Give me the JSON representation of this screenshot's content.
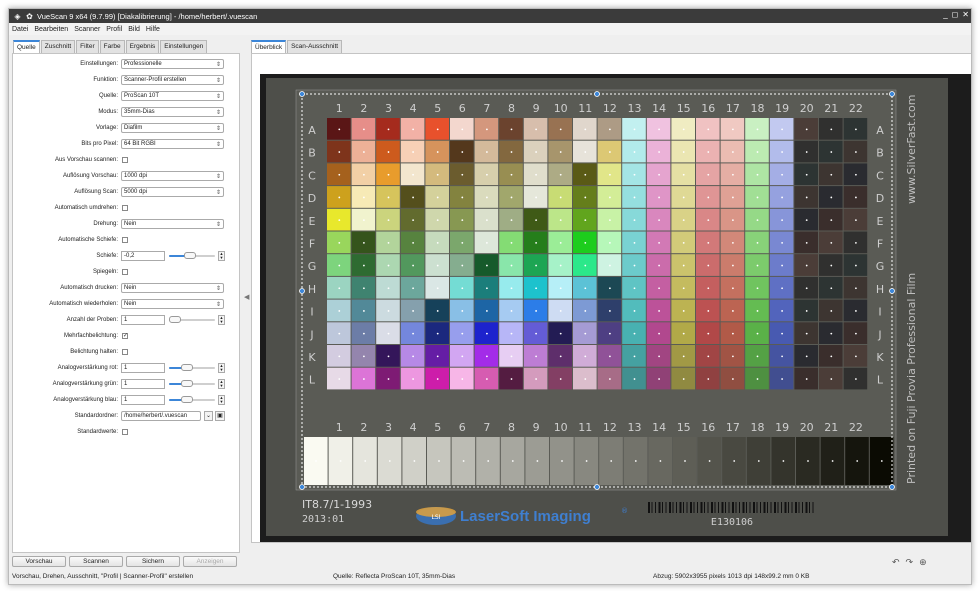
{
  "window": {
    "title": "VueScan 9 x64 (9.7.99) [Diakalibrierung] - /home/herbert/.vuescan",
    "controls": [
      "_",
      "◻",
      "✕"
    ]
  },
  "menu": [
    "Datei",
    "Bearbeiten",
    "Scanner",
    "Profil",
    "Bild",
    "Hilfe"
  ],
  "left_tabs": [
    "Quelle",
    "Zuschnitt",
    "Filter",
    "Farbe",
    "Ergebnis",
    "Einstellungen"
  ],
  "right_tabs": [
    "Überblick",
    "Scan-Ausschnitt"
  ],
  "settings": {
    "einstellungen": {
      "label": "Einstellungen:",
      "value": "Professionelle"
    },
    "funktion": {
      "label": "Funktion:",
      "value": "Scanner-Profil erstellen"
    },
    "quelle": {
      "label": "Quelle:",
      "value": "ProScan 10T"
    },
    "modus": {
      "label": "Modus:",
      "value": "35mm-Dias"
    },
    "vorlage": {
      "label": "Vorlage:",
      "value": "Diafilm"
    },
    "bits": {
      "label": "Bits pro Pixel:",
      "value": "64 Bit RGBI"
    },
    "aus_vorschau": {
      "label": "Aus Vorschau scannen:"
    },
    "aufl_vorschau": {
      "label": "Auflösung Vorschau:",
      "value": "1000 dpi"
    },
    "aufl_scan": {
      "label": "Auflösung Scan:",
      "value": "5000 dpi"
    },
    "auto_umdrehen": {
      "label": "Automatisch umdrehen:"
    },
    "drehung": {
      "label": "Drehung:",
      "value": "Nein"
    },
    "auto_schiefe": {
      "label": "Automatische Schiefe:"
    },
    "schiefe": {
      "label": "Schiefe:",
      "value": "-0,2",
      "level": 0.45
    },
    "spiegeln": {
      "label": "Spiegeln:"
    },
    "auto_drucken": {
      "label": "Automatisch drucken:",
      "value": "Nein"
    },
    "auto_wiederholen": {
      "label": "Automatisch wiederholen:",
      "value": "Nein"
    },
    "proben": {
      "label": "Anzahl der Proben:",
      "value": "1",
      "level": 0.0
    },
    "mehrfach": {
      "label": "Mehrfachbelichtung:",
      "checked": "✓"
    },
    "belichtung": {
      "label": "Belichtung halten:"
    },
    "verst_rot": {
      "label": "Analogverstärkung rot:",
      "value": "1",
      "level": 0.4
    },
    "verst_gruen": {
      "label": "Analogverstärkung grün:",
      "value": "1",
      "level": 0.4
    },
    "verst_blau": {
      "label": "Analogverstärkung blau:",
      "value": "1",
      "level": 0.4
    },
    "ordner": {
      "label": "Standardordner:",
      "value": "/home/herbert/.vuescan"
    },
    "standardwerte": {
      "label": "Standardwerte:"
    }
  },
  "buttons": {
    "vorschau": "Vorschau",
    "scannen": "Scannen",
    "sichern": "Sichern",
    "anzeigen": "Anzeigen"
  },
  "tools": {
    "rotate_left": "↶",
    "rotate_right": "↷",
    "zoom": "⊕"
  },
  "status": {
    "left": "Vorschau, Drehen, Ausschnitt, \"Profil | Scanner-Profil\" erstellen",
    "middle": "Quelle: Reflecta ProScan 10T, 35mm-Dias",
    "right": "Abzug: 5902x3955 pixels 1013 dpi 148x99.2 mm 0 KB"
  },
  "target": {
    "rows": [
      "A",
      "B",
      "C",
      "D",
      "E",
      "F",
      "G",
      "H",
      "I",
      "J",
      "K",
      "L"
    ],
    "cols": [
      "1",
      "2",
      "3",
      "4",
      "5",
      "6",
      "7",
      "8",
      "9",
      "10",
      "11",
      "12",
      "13",
      "14",
      "15",
      "16",
      "17",
      "18",
      "19",
      "20",
      "21",
      "22"
    ],
    "code": "IT8.7/1-1993",
    "date": "2013:01",
    "brand": "LaserSoft Imaging",
    "brand_mark": "®",
    "logo": "LSI",
    "barcode_text": "E130106",
    "side_url": "www.SilverFast.com",
    "side_film": "Printed on Fuji Provia Professional Film"
  }
}
